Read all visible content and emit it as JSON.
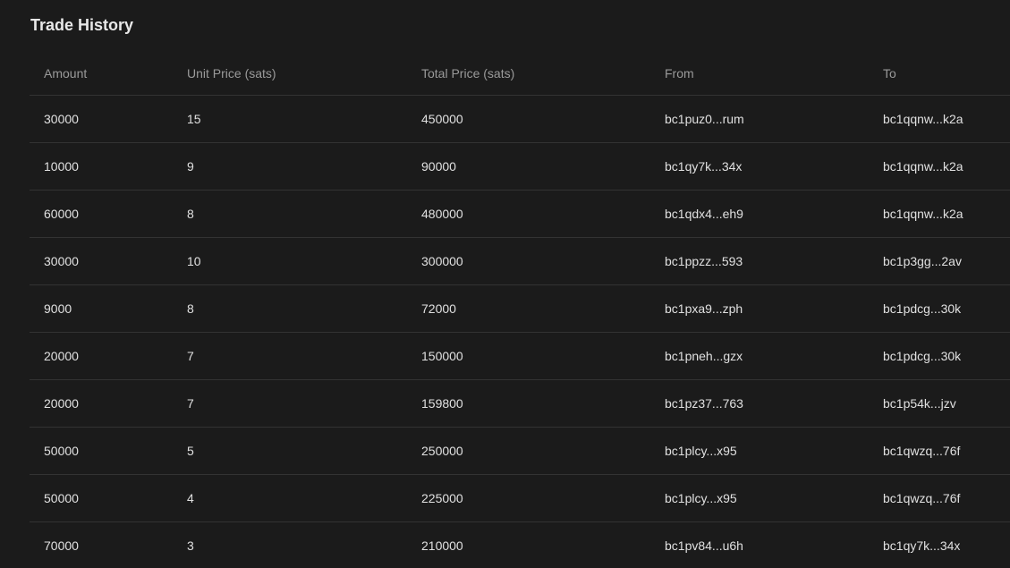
{
  "title": "Trade History",
  "columns": [
    "Amount",
    "Unit Price (sats)",
    "Total Price (sats)",
    "From",
    "To"
  ],
  "rows": [
    [
      "30000",
      "15",
      "450000",
      "bc1puz0...rum",
      "bc1qqnw...k2a"
    ],
    [
      "10000",
      "9",
      "90000",
      "bc1qy7k...34x",
      "bc1qqnw...k2a"
    ],
    [
      "60000",
      "8",
      "480000",
      "bc1qdx4...eh9",
      "bc1qqnw...k2a"
    ],
    [
      "30000",
      "10",
      "300000",
      "bc1ppzz...593",
      "bc1p3gg...2av"
    ],
    [
      "9000",
      "8",
      "72000",
      "bc1pxa9...zph",
      "bc1pdcg...30k"
    ],
    [
      "20000",
      "7",
      "150000",
      "bc1pneh...gzx",
      "bc1pdcg...30k"
    ],
    [
      "20000",
      "7",
      "159800",
      "bc1pz37...763",
      "bc1p54k...jzv"
    ],
    [
      "50000",
      "5",
      "250000",
      "bc1plcy...x95",
      "bc1qwzq...76f"
    ],
    [
      "50000",
      "4",
      "225000",
      "bc1plcy...x95",
      "bc1qwzq...76f"
    ],
    [
      "70000",
      "3",
      "210000",
      "bc1pv84...u6h",
      "bc1qy7k...34x"
    ]
  ]
}
